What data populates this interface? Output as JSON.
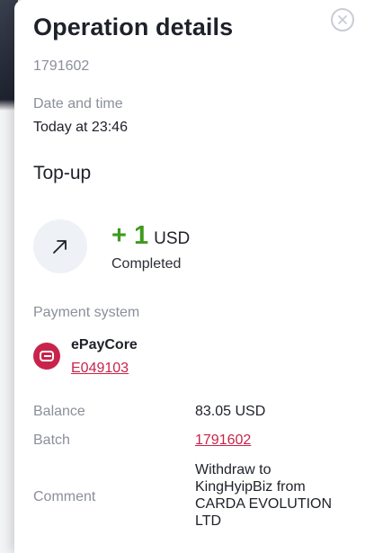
{
  "dialog": {
    "title": "Operation details",
    "operation_id": "1791602",
    "close_icon": "close-icon"
  },
  "datetime": {
    "label": "Date and time",
    "value": "Today at 23:46"
  },
  "operation": {
    "type": "Top-up",
    "direction_icon": "arrow-up-right-icon",
    "amount": "+ 1",
    "currency": "USD",
    "status": "Completed",
    "amount_color": "#3f9a1f"
  },
  "payment": {
    "label": "Payment system",
    "name": "ePayCore",
    "account": "E049103",
    "icon": "epaycore-logo-icon",
    "brand_color": "#c8244b"
  },
  "details": {
    "balance_label": "Balance",
    "balance_value": "83.05 USD",
    "batch_label": "Batch",
    "batch_value": "1791602",
    "comment_label": "Comment",
    "comment_value": "Withdraw to KingHyipBiz from CARDA EVOLUTION LTD"
  }
}
